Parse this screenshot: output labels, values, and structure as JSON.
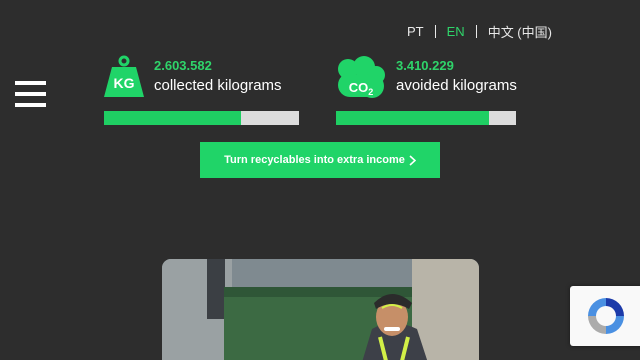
{
  "languages": [
    {
      "code": "PT",
      "active": false
    },
    {
      "code": "EN",
      "active": true
    },
    {
      "code": "中文 (中国)",
      "active": false
    }
  ],
  "menu": {
    "icon": "hamburger-menu-icon"
  },
  "stats": {
    "kg": {
      "icon": "weight-kg-icon",
      "icon_text": "KG",
      "value": "2.603.582",
      "label": "collected kilograms",
      "progress": 0.7
    },
    "co2": {
      "icon": "cloud-co2-icon",
      "icon_text": "CO",
      "icon_sub": "2",
      "value": "3.410.229",
      "label": "avoided kilograms",
      "progress": 0.85
    }
  },
  "cta": {
    "label": "Turn recyclables into extra income",
    "icon": "chevron-right-icon"
  },
  "photo": {
    "description_icon": "cyclist-photo"
  },
  "recaptcha": {
    "icon": "recaptcha-icon"
  },
  "colors": {
    "accent": "#20d468",
    "background": "#2d2d2d",
    "progress_track": "#dcdcdc"
  }
}
